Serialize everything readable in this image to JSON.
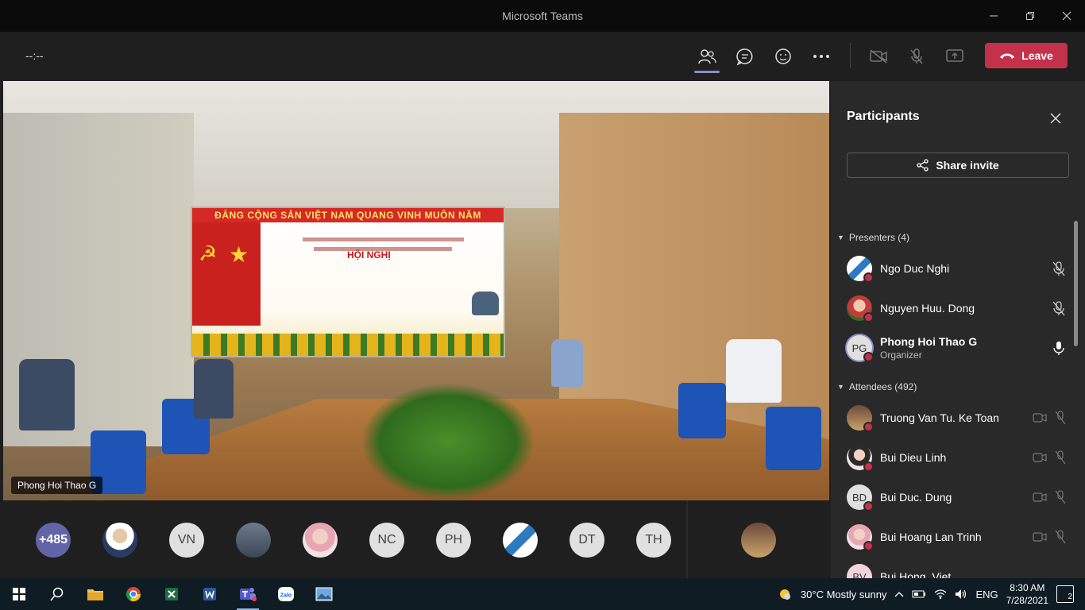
{
  "window": {
    "title": "Microsoft Teams"
  },
  "meeting": {
    "timer": "--:--",
    "leave_label": "Leave"
  },
  "video": {
    "presenter_label": "Phong Hoi Thao G",
    "screen_banner": "ĐẢNG CỘNG SẢN VIỆT NAM QUANG VINH MUÔN NĂM",
    "screen_heading": "HỘI NGHỊ"
  },
  "strip": {
    "overflow_count": "+485",
    "avatars": [
      "VN",
      "NC",
      "PH",
      "DT",
      "TH"
    ]
  },
  "panel": {
    "title": "Participants",
    "share_label": "Share invite",
    "presenters_label": "Presenters (4)",
    "attendees_label": "Attendees (492)",
    "presenters": [
      {
        "name": "Ngo Duc Nghi"
      },
      {
        "name": "Nguyen Huu. Dong"
      },
      {
        "name": "Phong Hoi Thao G",
        "initials": "PG",
        "role": "Organizer"
      }
    ],
    "attendees": [
      {
        "name": "Truong Van Tu. Ke Toan"
      },
      {
        "name": "Bui Dieu Linh"
      },
      {
        "name": "Bui Duc. Dung",
        "initials": "BD"
      },
      {
        "name": "Bui Hoang Lan Trinh"
      },
      {
        "name": "Bui Hong. Viet",
        "initials": "BV"
      }
    ]
  },
  "taskbar": {
    "weather": "30°C  Mostly sunny",
    "language": "ENG",
    "time": "8:30 AM",
    "date": "7/28/2021",
    "notifications": "2"
  },
  "colors": {
    "leave": "#c4314b",
    "accent": "#6264a7",
    "panel": "#292929"
  }
}
